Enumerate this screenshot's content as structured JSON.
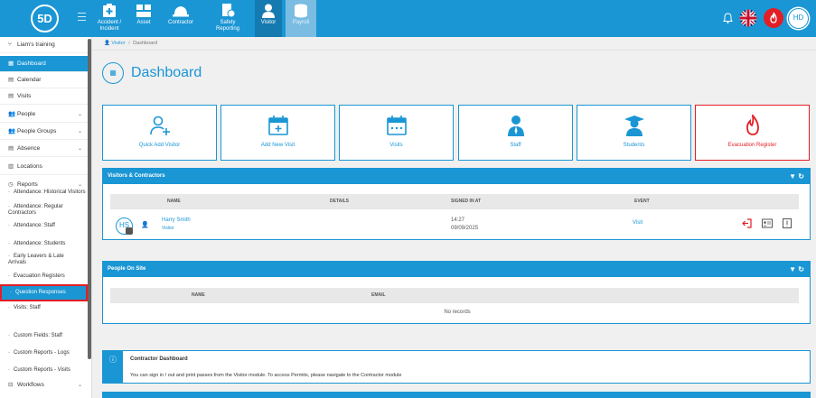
{
  "app": {
    "logo_text": "5D",
    "user_initials": "HD",
    "colors": {
      "primary": "#1a96d4",
      "danger": "#e31e24",
      "success": "#2e8b2e"
    }
  },
  "modules": [
    {
      "label1": "Accident /",
      "label2": "Incident",
      "icon": "first-aid-icon"
    },
    {
      "label1": "Asset",
      "label2": "",
      "icon": "boxes-icon"
    },
    {
      "label1": "Contractor",
      "label2": "",
      "icon": "hard-hat-icon"
    },
    {
      "label1": "Safety",
      "label2": "Reporting",
      "icon": "safety-report-icon"
    },
    {
      "label1": "Visitor",
      "label2": "",
      "icon": "visitor-icon"
    },
    {
      "label1": "Payroll",
      "label2": "",
      "icon": "coins-icon"
    }
  ],
  "sidebar": {
    "training": "Liam's training",
    "items": [
      {
        "label": "Dashboard",
        "icon": "▦"
      },
      {
        "label": "Calendar",
        "icon": "▤"
      },
      {
        "label": "Visits",
        "icon": "▤"
      },
      {
        "label": "People",
        "icon": "👥"
      },
      {
        "label": "People Groups",
        "icon": "👥"
      },
      {
        "label": "Absence",
        "icon": "▤"
      },
      {
        "label": "Locations",
        "icon": "▥"
      },
      {
        "label": "Reports",
        "icon": "◷"
      }
    ],
    "chevron": "⌄",
    "subitems": {
      "att_hist": "Attendance: Historical Visitors",
      "att_reg": "Attendance: Regular Contractors",
      "att_staff": "Attendance: Staff",
      "att_students": "Attendance: Students",
      "early": "Early Leavers & Late Arrivals",
      "evac": "Evacuation Registers",
      "question": "Question Responses",
      "visits_staff": "Visits: Staff",
      "custom_fields": "Custom Fields: Staff",
      "custom_logs": "Custom Reports - Logs",
      "custom_visits": "Custom Reports - Visits"
    },
    "workflows": "Workflows",
    "workflows_icon": "⊟"
  },
  "breadcrumb": {
    "first": "Visitor",
    "sep": "/",
    "current": "Dashboard"
  },
  "page": {
    "title": "Dashboard",
    "icon_glyph": "▦"
  },
  "tiles": [
    {
      "label": "Quick Add Visitor"
    },
    {
      "label": "Add New Visit"
    },
    {
      "label": "Visits"
    },
    {
      "label": "Staff"
    },
    {
      "label": "Students"
    },
    {
      "label": "Evacuation Register"
    }
  ],
  "visitors_panel": {
    "title": "Visitors & Contractors",
    "columns": {
      "name": "NAME",
      "details": "DETAILS",
      "signed_in": "SIGNED IN AT",
      "event": "EVENT"
    },
    "row": {
      "initials": "HS",
      "name": "Harry Smith",
      "role": "Visitor",
      "time": "14:27",
      "date": "09/09/2025",
      "event": "Visit"
    }
  },
  "people_panel": {
    "title": "People On Site",
    "columns": {
      "name": "NAME",
      "email": "EMAIL"
    },
    "empty": "No records"
  },
  "info": {
    "icon_glyph": "ⓘ",
    "title": "Contractor Dashboard",
    "text": "You can sign in / out and print passes from the Visitor module. To access Permits, please navigate to the Contractor module"
  }
}
